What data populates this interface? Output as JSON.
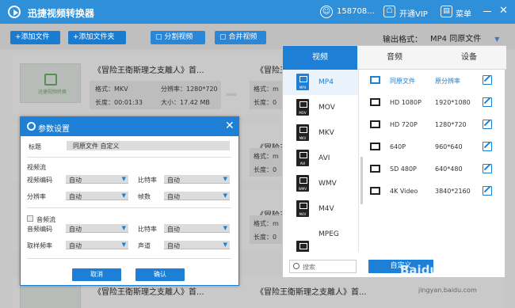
{
  "app": {
    "title": "迅捷视频转换器",
    "username": "158708...",
    "vip": "开通VIP",
    "menu": "菜单",
    "close": "✕"
  },
  "toolbar": {
    "add_file": "+添加文件",
    "add_folder": "+添加文件夹",
    "split": "▢ 分割视频",
    "merge": "▢ 合并视频",
    "output_label": "输出格式：",
    "output_value": "MP4  同原文件"
  },
  "files": [
    {
      "name": "《冒险王衛斯理之支離人》首...",
      "name2": "《冒险王衛斯理之支離人》首...",
      "format": "格式：MKV",
      "resolution": "分辨率：1280*720",
      "duration": "长度：00:01:33",
      "size": "大小：17.42 MB",
      "format2": "格式：m",
      "duration2": "长度：0"
    },
    {
      "name": "",
      "name2": "《冒险王衛斯理之支離人》首...",
      "format": "",
      "resolution": "",
      "duration": "",
      "size": "",
      "format2": "格式：m",
      "duration2": "长度：0"
    },
    {
      "name": "",
      "name2": "《冒险王衛斯理之支離人》首...",
      "format": "",
      "resolution": "",
      "duration": "",
      "size": "",
      "format2": "格式：m",
      "duration2": "长度：0"
    },
    {
      "name": "",
      "name2": "《冒险王衛斯理之支離人》首...",
      "format": "",
      "resolution": "",
      "duration": "",
      "size": "",
      "format2": "",
      "duration2": ""
    }
  ],
  "last_row": {
    "name": "《冒险王衛斯理之支離人》首...",
    "name2": "《冒险王衛斯理之支離人》首..."
  },
  "thumb_text": "迅捷视频转换",
  "format_panel": {
    "tabs": [
      "视频",
      "音频",
      "设备"
    ],
    "formats": [
      "MP4",
      "MOV",
      "MKV",
      "AVI",
      "WMV",
      "M4V",
      "MPEG"
    ],
    "resolutions": [
      {
        "name": "同原文件",
        "value": "原分辨率"
      },
      {
        "name": "HD 1080P",
        "value": "1920*1080"
      },
      {
        "name": "HD 720P",
        "value": "1280*720"
      },
      {
        "name": "640P",
        "value": "960*640"
      },
      {
        "name": "SD 480P",
        "value": "640*480"
      },
      {
        "name": "4K Video",
        "value": "3840*2160"
      }
    ],
    "search_placeholder": "搜索",
    "customize": "自定义"
  },
  "dialog": {
    "title": "参数设置",
    "close": "✕",
    "title_label": "标题",
    "title_value": "同原文件 自定义",
    "video_section": "视频流",
    "video_codec_label": "视频编码",
    "video_codec": "自动",
    "bitrate_label": "比特率",
    "bitrate": "自动",
    "resolution_label": "分辨率",
    "resolution": "自动",
    "fps_label": "帧数",
    "fps": "自动",
    "audio_section": "音频流",
    "audio_codec_label": "音频编码",
    "audio_codec": "自动",
    "audio_bitrate_label": "比特率",
    "audio_bitrate": "自动",
    "samplerate_label": "取样频率",
    "samplerate": "自动",
    "channel_label": "声道",
    "channel": "自动",
    "cancel": "取消",
    "confirm": "确认"
  },
  "watermark": {
    "logo": "Baidu经验",
    "url": "jingyan.baidu.com"
  },
  "colors": {
    "accent": "#1d7fd5",
    "titlebar": "#2f8fd9"
  }
}
